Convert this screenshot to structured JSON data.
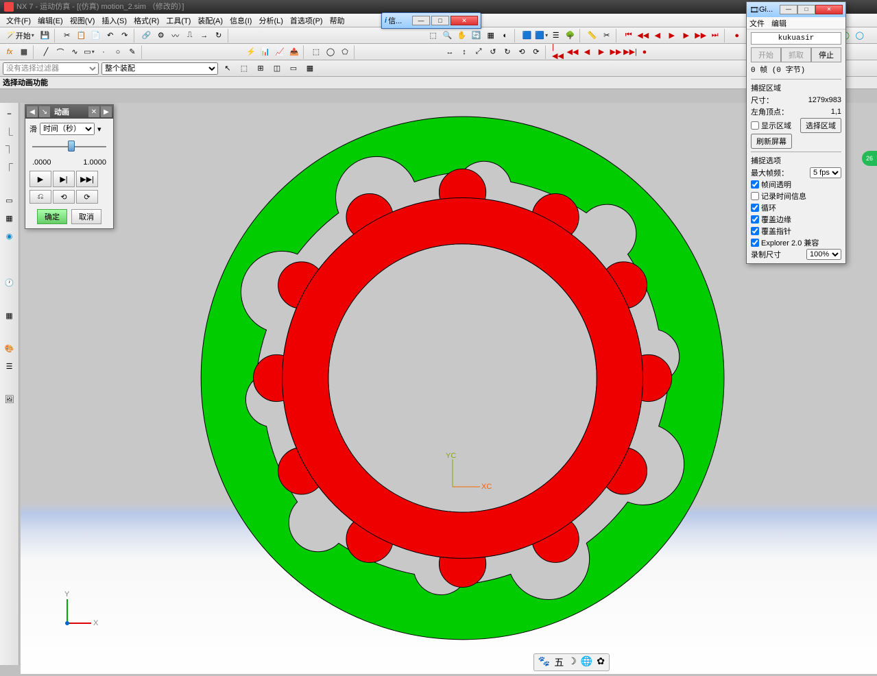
{
  "app": {
    "title": "NX 7 - 运动仿真 - [(仿真) motion_2.sim （修改的）]"
  },
  "menu": {
    "items": [
      "文件(F)",
      "编辑(E)",
      "视图(V)",
      "插入(S)",
      "格式(R)",
      "工具(T)",
      "装配(A)",
      "信息(I)",
      "分析(L)",
      "首选项(P)",
      "帮助"
    ]
  },
  "start_btn": "开始",
  "selectbar": {
    "filter_placeholder": "没有选择过滤器",
    "scope": "整个装配"
  },
  "status_label": "选择动画功能",
  "anim": {
    "title": "动画",
    "slide_label": "滑",
    "mode": "时间（秒）",
    "min": ".0000",
    "max": "1.0000",
    "ok": "确定",
    "cancel": "取消"
  },
  "info_window": {
    "title": "信..."
  },
  "gif": {
    "title": "Gi...",
    "menu": [
      "文件",
      "编辑"
    ],
    "name": "kukuasir",
    "tabs": [
      "开始",
      "抓取",
      "停止"
    ],
    "status": "0 帧 (0 字节)",
    "capture_area": "捕捉区域",
    "size_label": "尺寸：",
    "size_value": "1279x983",
    "corner_label": "左角顶点：",
    "corner_value": "1,1",
    "show_area": "显示区域",
    "select_area": "选择区域",
    "refresh": "刷新屏幕",
    "capture_opts": "捕捉选项",
    "max_fps_label": "最大帧频：",
    "max_fps_value": "5 fps",
    "opt_transparent": "帧间透明",
    "opt_timeinfo": "记录时间信息",
    "opt_loop": "循环",
    "opt_edge": "覆盖边缘",
    "opt_cursor": "覆盖指针",
    "opt_explorer": "Explorer 2.0 兼容",
    "rec_size_label": "录制尺寸",
    "rec_size_value": "100%"
  },
  "badge": "26",
  "axis": {
    "x": "X",
    "y": "Y",
    "xc": "XC",
    "yc": "YC"
  },
  "bottom": {
    "items": [
      "🐾",
      "五",
      "☽",
      "🌐",
      "✿"
    ]
  }
}
